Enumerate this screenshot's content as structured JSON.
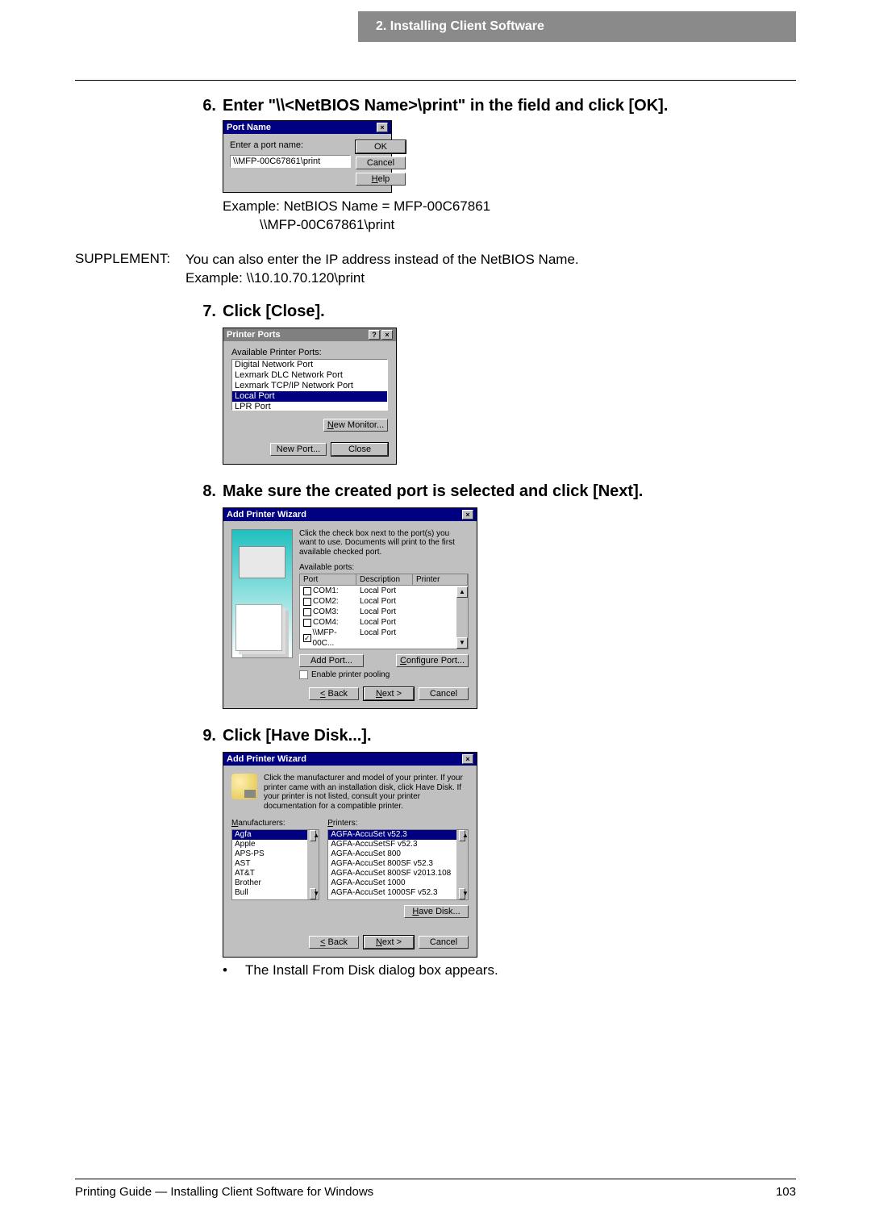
{
  "header": {
    "chapter": "2. Installing Client Software"
  },
  "steps": {
    "s6": {
      "num": "6.",
      "title": "Enter \"\\\\<NetBIOS Name>\\print\" in the field and click [OK].",
      "example_line1": "Example: NetBIOS Name = MFP-00C67861",
      "example_line2": "\\\\MFP-00C67861\\print"
    },
    "supplement": {
      "label": "SUPPLEMENT:",
      "line1": "You can also enter the IP address instead of the NetBIOS Name.",
      "line2": "Example: \\\\10.10.70.120\\print"
    },
    "s7": {
      "num": "7.",
      "title": "Click [Close]."
    },
    "s8": {
      "num": "8.",
      "title": "Make sure the created port is selected and click [Next]."
    },
    "s9": {
      "num": "9.",
      "title": "Click [Have Disk...].",
      "bullet": "The Install From Disk dialog box appears."
    }
  },
  "dlg_port_name": {
    "title": "Port Name",
    "label": "Enter a port name:",
    "value": "\\\\MFP-00C67861\\print",
    "ok": "OK",
    "cancel": "Cancel",
    "help": "Help"
  },
  "dlg_printer_ports": {
    "title": "Printer Ports",
    "available_label": "Available Printer Ports:",
    "items": [
      "Digital Network Port",
      "Lexmark DLC Network Port",
      "Lexmark TCP/IP Network Port",
      "Local Port",
      "LPR Port"
    ],
    "selected_index": 3,
    "new_monitor": "New Monitor...",
    "new_port": "New Port...",
    "close": "Close"
  },
  "dlg_apw_ports": {
    "title": "Add Printer Wizard",
    "instruction": "Click the check box next to the port(s) you want to use. Documents will print to the first available checked port.",
    "available_label": "Available ports:",
    "headers": {
      "port": "Port",
      "desc": "Description",
      "printer": "Printer"
    },
    "rows": [
      {
        "port": "COM1:",
        "desc": "Local Port",
        "checked": false
      },
      {
        "port": "COM2:",
        "desc": "Local Port",
        "checked": false
      },
      {
        "port": "COM3:",
        "desc": "Local Port",
        "checked": false
      },
      {
        "port": "COM4:",
        "desc": "Local Port",
        "checked": false
      },
      {
        "port": "\\\\MFP-00C...",
        "desc": "Local Port",
        "checked": true
      }
    ],
    "add_port": "Add Port...",
    "configure_port": "Configure Port...",
    "enable_pooling": "Enable printer pooling",
    "back": "< Back",
    "next": "Next >",
    "cancel": "Cancel"
  },
  "dlg_apw_disk": {
    "title": "Add Printer Wizard",
    "instruction": "Click the manufacturer and model of your printer. If your printer came with an installation disk, click Have Disk. If your printer is not listed, consult your printer documentation for a compatible printer.",
    "manufacturers_label": "Manufacturers:",
    "printers_label": "Printers:",
    "manufacturers": [
      "Agfa",
      "Apple",
      "APS-PS",
      "AST",
      "AT&T",
      "Brother",
      "Bull"
    ],
    "manufacturers_selected": 0,
    "printers": [
      "AGFA-AccuSet v52.3",
      "AGFA-AccuSetSF v52.3",
      "AGFA-AccuSet 800",
      "AGFA-AccuSet 800SF v52.3",
      "AGFA-AccuSet 800SF v2013.108",
      "AGFA-AccuSet 1000",
      "AGFA-AccuSet 1000SF v52.3"
    ],
    "printers_selected": 0,
    "have_disk": "Have Disk...",
    "back": "< Back",
    "next": "Next >",
    "cancel": "Cancel"
  },
  "footer": {
    "left": "Printing Guide — Installing Client Software for Windows",
    "right": "103"
  }
}
